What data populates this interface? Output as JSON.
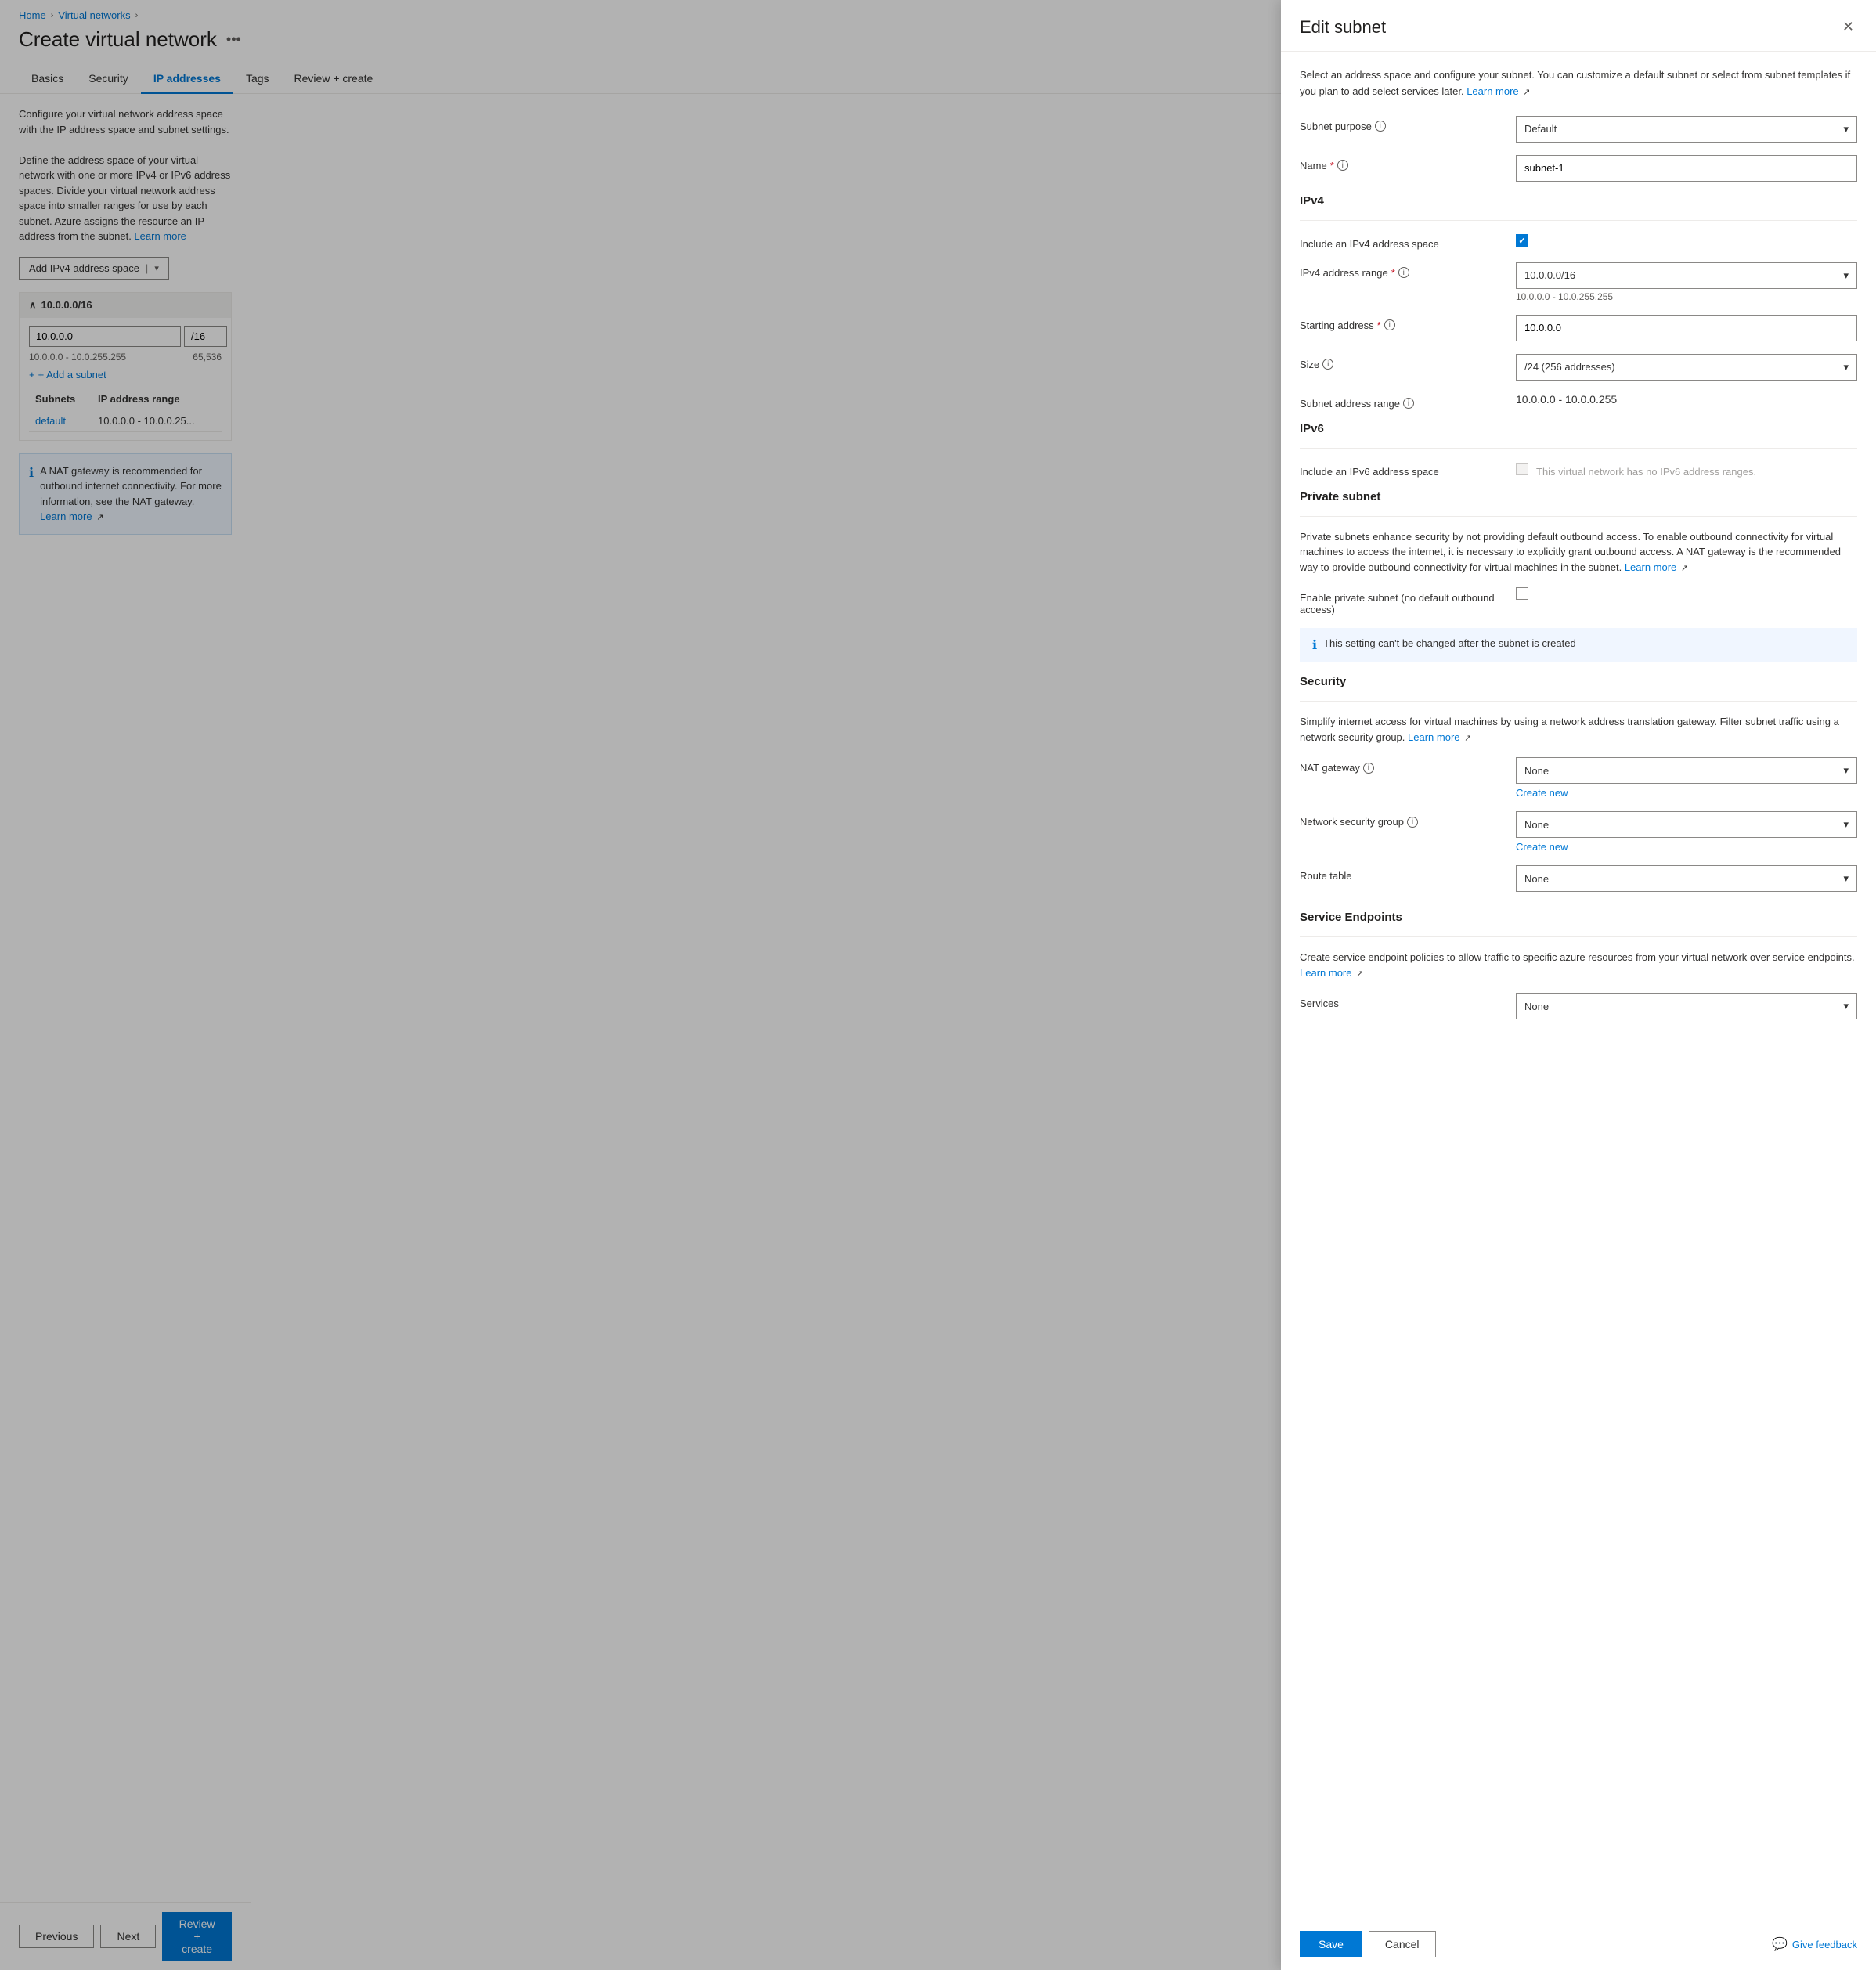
{
  "breadcrumb": {
    "home": "Home",
    "virtual_networks": "Virtual networks"
  },
  "page": {
    "title": "Create virtual network",
    "more_icon": "•••"
  },
  "tabs": [
    {
      "label": "Basics",
      "active": false
    },
    {
      "label": "Security",
      "active": false
    },
    {
      "label": "IP addresses",
      "active": true
    },
    {
      "label": "Tags",
      "active": false
    },
    {
      "label": "Review + create",
      "active": false
    }
  ],
  "left_panel": {
    "description": "Configure your virtual network address space with the IP address space and subnet settings.",
    "description2": "Define the address space of your virtual network with one or more IPv4 or IPv6 address spaces. Divide your virtual network address space into smaller ranges for use by each subnet. Azure assigns the resource an IP address from the subnet.",
    "learn_more": "Learn more",
    "add_address_btn": "Add IPv4 address space",
    "address_space": {
      "label": "10.0.0.0/16",
      "ip_value": "10.0.0",
      "prefix": "/16",
      "range": "10.0.0.0 - 10.0.255.255",
      "available": "65,536"
    },
    "add_subnet": "+ Add a subnet",
    "subnets_table": {
      "col1": "Subnets",
      "col2": "IP address range",
      "rows": [
        {
          "name": "default",
          "range": "10.0.0.0 - 10.0.0.25..."
        }
      ]
    },
    "info_box": {
      "text": "A NAT gateway is recommended for outbound internet connectivity. For more information, see the NAT gateway.",
      "learn_more": "Learn more"
    }
  },
  "bottom_bar": {
    "previous": "Previous",
    "next": "Next",
    "review_create": "Review + create",
    "give_feedback": "Give feedback"
  },
  "panel": {
    "title": "Edit subnet",
    "description": "Select an address space and configure your subnet. You can customize a default subnet or select from subnet templates if you plan to add select services later.",
    "learn_more": "Learn more",
    "subnet_purpose_label": "Subnet purpose",
    "subnet_purpose_value": "Default",
    "name_label": "Name",
    "name_required": "*",
    "name_value": "subnet-1",
    "ipv4_heading": "IPv4",
    "include_ipv4_label": "Include an IPv4 address space",
    "ipv4_checked": true,
    "ipv4_range_label": "IPv4 address range",
    "ipv4_range_required": "*",
    "ipv4_range_value": "10.0.0.0/16",
    "ipv4_range_sub": "10.0.0.0 - 10.0.255.255",
    "starting_address_label": "Starting address",
    "starting_address_required": "*",
    "starting_address_value": "10.0.0.0",
    "size_label": "Size",
    "size_value": "/24 (256 addresses)",
    "subnet_address_range_label": "Subnet address range",
    "subnet_address_range_value": "10.0.0.0 - 10.0.0.255",
    "ipv6_heading": "IPv6",
    "include_ipv6_label": "Include an IPv6 address space",
    "ipv6_note": "This virtual network has no IPv6 address ranges.",
    "private_subnet_heading": "Private subnet",
    "private_subnet_desc": "Private subnets enhance security by not providing default outbound access. To enable outbound connectivity for virtual machines to access the internet, it is necessary to explicitly grant outbound access. A NAT gateway is the recommended way to provide outbound connectivity for virtual machines in the subnet.",
    "private_subnet_learn_more": "Learn more",
    "enable_private_subnet_label": "Enable private subnet (no default outbound access)",
    "info_banner": "This setting can't be changed after the subnet is created",
    "security_heading": "Security",
    "security_desc": "Simplify internet access for virtual machines by using a network address translation gateway. Filter subnet traffic using a network security group.",
    "security_learn_more": "Learn more",
    "nat_gateway_label": "NAT gateway",
    "nat_gateway_value": "None",
    "nat_gateway_create_new": "Create new",
    "nsg_label": "Network security group",
    "nsg_value": "None",
    "nsg_create_new": "Create new",
    "route_table_label": "Route table",
    "route_table_value": "None",
    "service_endpoints_heading": "Service Endpoints",
    "service_endpoints_desc": "Create service endpoint policies to allow traffic to specific azure resources from your virtual network over service endpoints.",
    "service_endpoints_learn_more": "Learn more",
    "services_label": "Services",
    "services_value": "None",
    "save_label": "Save",
    "cancel_label": "Cancel"
  }
}
